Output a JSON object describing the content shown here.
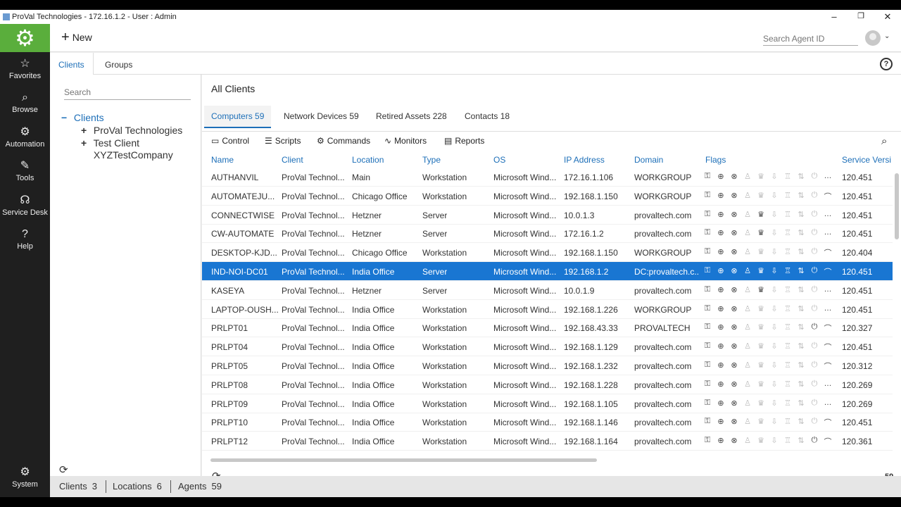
{
  "window": {
    "title": "ProVal Technologies - 172.16.1.2 - User : Admin",
    "minimize": "–",
    "restore": "❐",
    "close": "✕"
  },
  "nav": {
    "items": [
      {
        "label": "Favorites",
        "icon": "☆"
      },
      {
        "label": "Browse",
        "icon": "⌕"
      },
      {
        "label": "Automation",
        "icon": "⚙"
      },
      {
        "label": "Tools",
        "icon": "✎"
      },
      {
        "label": "Service Desk",
        "icon": "☊"
      },
      {
        "label": "Help",
        "icon": "?"
      },
      {
        "label": "System",
        "icon": "⚙"
      }
    ]
  },
  "topbar": {
    "new_label": "New",
    "search_placeholder": "Search Agent ID"
  },
  "left_tabs": {
    "clients": "Clients",
    "groups": "Groups"
  },
  "tree": {
    "search_placeholder": "Search",
    "root": {
      "toggle": "−",
      "label": "Clients"
    },
    "children": [
      {
        "toggle": "+",
        "label": "ProVal Technologies"
      },
      {
        "toggle": "+",
        "label": "Test Client"
      },
      {
        "toggle": "",
        "label": "XYZTestCompany"
      }
    ]
  },
  "main": {
    "title": "All Clients",
    "subtabs": {
      "computers": "Computers 59",
      "network": "Network Devices 59",
      "retired": "Retired Assets 228",
      "contacts": "Contacts 18"
    },
    "toolbar": {
      "control": "Control",
      "scripts": "Scripts",
      "commands": "Commands",
      "monitors": "Monitors",
      "reports": "Reports"
    },
    "columns": {
      "name": "Name",
      "client": "Client",
      "location": "Location",
      "type": "Type",
      "os": "OS",
      "ip": "IP Address",
      "domain": "Domain",
      "flags": "Flags",
      "service": "Service Versi"
    },
    "rows": [
      {
        "name": "AUTHANVIL",
        "client": "ProVal Technol...",
        "location": "Main",
        "type": "Workstation",
        "os": "Microsoft Wind...",
        "ip": "172.16.1.106",
        "domain": "WORKGROUP",
        "service": "120.451",
        "f": [
          1,
          1,
          1,
          0,
          0,
          0,
          0,
          0,
          0,
          2
        ]
      },
      {
        "name": "AUTOMATEJU...",
        "client": "ProVal Technol...",
        "location": "Chicago Office",
        "type": "Workstation",
        "os": "Microsoft Wind...",
        "ip": "192.168.1.150",
        "domain": "WORKGROUP",
        "service": "120.451",
        "f": [
          1,
          1,
          1,
          0,
          0,
          0,
          0,
          0,
          0,
          1
        ]
      },
      {
        "name": "CONNECTWISE",
        "client": "ProVal Technol...",
        "location": "Hetzner",
        "type": "Server",
        "os": "Microsoft Wind...",
        "ip": "10.0.1.3",
        "domain": "provaltech.com",
        "service": "120.451",
        "f": [
          1,
          1,
          1,
          0,
          1,
          0,
          0,
          0,
          0,
          2
        ]
      },
      {
        "name": "CW-AUTOMATE",
        "client": "ProVal Technol...",
        "location": "Hetzner",
        "type": "Server",
        "os": "Microsoft Wind...",
        "ip": "172.16.1.2",
        "domain": "provaltech.com",
        "service": "120.451",
        "f": [
          1,
          1,
          1,
          0,
          1,
          0,
          0,
          0,
          0,
          2
        ]
      },
      {
        "name": "DESKTOP-KJD...",
        "client": "ProVal Technol...",
        "location": "Chicago Office",
        "type": "Workstation",
        "os": "Microsoft Wind...",
        "ip": "192.168.1.150",
        "domain": "WORKGROUP",
        "service": "120.404",
        "f": [
          1,
          1,
          1,
          0,
          0,
          0,
          0,
          0,
          0,
          1
        ]
      },
      {
        "name": "IND-NOI-DC01",
        "client": "ProVal Technol...",
        "location": "India Office",
        "type": "Server",
        "os": "Microsoft Wind...",
        "ip": "192.168.1.2",
        "domain": "DC:provaltech.c...",
        "service": "120.451",
        "f": [
          1,
          1,
          1,
          0,
          1,
          0,
          1,
          0,
          0,
          1
        ]
      },
      {
        "name": "KASEYA",
        "client": "ProVal Technol...",
        "location": "Hetzner",
        "type": "Server",
        "os": "Microsoft Wind...",
        "ip": "10.0.1.9",
        "domain": "provaltech.com",
        "service": "120.451",
        "f": [
          1,
          1,
          1,
          0,
          1,
          0,
          0,
          0,
          0,
          2
        ]
      },
      {
        "name": "LAPTOP-OUSH...",
        "client": "ProVal Technol...",
        "location": "India Office",
        "type": "Workstation",
        "os": "Microsoft Wind...",
        "ip": "192.168.1.226",
        "domain": "WORKGROUP",
        "service": "120.451",
        "f": [
          1,
          1,
          1,
          0,
          0,
          0,
          0,
          0,
          0,
          2
        ]
      },
      {
        "name": "PRLPT01",
        "client": "ProVal Technol...",
        "location": "India Office",
        "type": "Workstation",
        "os": "Microsoft Wind...",
        "ip": "192.168.43.33",
        "domain": "PROVALTECH",
        "service": "120.327",
        "f": [
          1,
          1,
          1,
          0,
          0,
          0,
          0,
          0,
          1,
          1
        ]
      },
      {
        "name": "PRLPT04",
        "client": "ProVal Technol...",
        "location": "India Office",
        "type": "Workstation",
        "os": "Microsoft Wind...",
        "ip": "192.168.1.129",
        "domain": "provaltech.com",
        "service": "120.451",
        "f": [
          1,
          1,
          1,
          0,
          0,
          0,
          0,
          0,
          0,
          1
        ]
      },
      {
        "name": "PRLPT05",
        "client": "ProVal Technol...",
        "location": "India Office",
        "type": "Workstation",
        "os": "Microsoft Wind...",
        "ip": "192.168.1.232",
        "domain": "provaltech.com",
        "service": "120.312",
        "f": [
          1,
          1,
          1,
          0,
          0,
          0,
          0,
          0,
          0,
          1
        ]
      },
      {
        "name": "PRLPT08",
        "client": "ProVal Technol...",
        "location": "India Office",
        "type": "Workstation",
        "os": "Microsoft Wind...",
        "ip": "192.168.1.228",
        "domain": "provaltech.com",
        "service": "120.269",
        "f": [
          1,
          1,
          1,
          0,
          0,
          0,
          0,
          0,
          0,
          2
        ]
      },
      {
        "name": "PRLPT09",
        "client": "ProVal Technol...",
        "location": "India Office",
        "type": "Workstation",
        "os": "Microsoft Wind...",
        "ip": "192.168.1.105",
        "domain": "provaltech.com",
        "service": "120.269",
        "f": [
          1,
          1,
          1,
          0,
          0,
          0,
          0,
          0,
          0,
          2
        ]
      },
      {
        "name": "PRLPT10",
        "client": "ProVal Technol...",
        "location": "India Office",
        "type": "Workstation",
        "os": "Microsoft Wind...",
        "ip": "192.168.1.146",
        "domain": "provaltech.com",
        "service": "120.451",
        "f": [
          1,
          1,
          1,
          0,
          0,
          0,
          0,
          0,
          0,
          1
        ]
      },
      {
        "name": "PRLPT12",
        "client": "ProVal Technol...",
        "location": "India Office",
        "type": "Workstation",
        "os": "Microsoft Wind...",
        "ip": "192.168.1.164",
        "domain": "provaltech.com",
        "service": "120.361",
        "f": [
          1,
          1,
          1,
          0,
          0,
          0,
          0,
          0,
          1,
          1
        ]
      }
    ],
    "selected_row": 5,
    "count": "59"
  },
  "status": {
    "clients_label": "Clients",
    "clients_val": "3",
    "locations_label": "Locations",
    "locations_val": "6",
    "agents_label": "Agents",
    "agents_val": "59"
  },
  "colors": {
    "accent": "#1d6fb8",
    "brand": "#5aae3c",
    "selection": "#1976d2",
    "nav_bg": "#1f1f1f"
  }
}
